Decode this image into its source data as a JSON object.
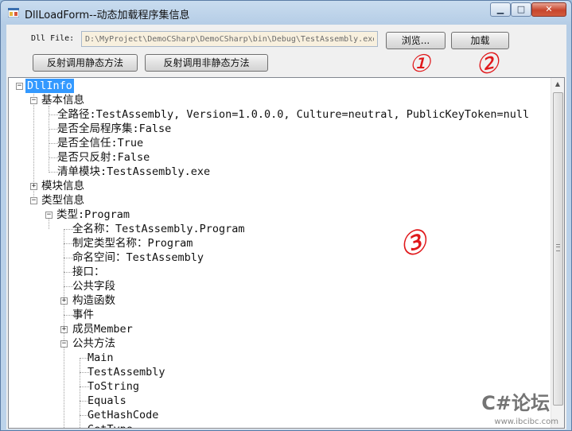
{
  "window": {
    "title": "DllLoadForm--动态加载程序集信息",
    "min_glyph": "▁",
    "max_glyph": "□",
    "close_glyph": "✕"
  },
  "toolbar": {
    "dll_label": "Dll File:",
    "dll_path": "D:\\MyProject\\DemoCSharp\\DemoCSharp\\bin\\Debug\\TestAssembly.exe",
    "browse_label": "浏览...",
    "load_label": "加载",
    "invoke_static_label": "反射调用静态方法",
    "invoke_nonstatic_label": "反射调用非静态方法"
  },
  "annotations": {
    "mark1": "①",
    "mark2": "②",
    "mark3": "③"
  },
  "tree": {
    "root": "DllInfo",
    "basic": "基本信息",
    "full_path": "全路径:TestAssembly, Version=1.0.0.0, Culture=neutral, PublicKeyToken=null",
    "is_gac": "是否全局程序集:False",
    "is_full_trust": "是否全信任:True",
    "is_reflection_only": "是否只反射:False",
    "manifest_module": "清单模块:TestAssembly.exe",
    "modules": "模块信息",
    "types": "类型信息",
    "type_program": "类型:Program",
    "full_name": "全名称：TestAssembly.Program",
    "declared_name": "制定类型名称：Program",
    "namespace": "命名空间：TestAssembly",
    "interfaces": "接口：",
    "public_fields": "公共字段",
    "constructors": "构造函数",
    "events": "事件",
    "members": "成员Member",
    "public_methods": "公共方法",
    "methods": [
      "Main",
      "TestAssembly",
      "ToString",
      "Equals",
      "GetHashCode",
      "GetType"
    ],
    "expander_plus": "+",
    "expander_minus": "−"
  },
  "scrollbar": {
    "up_glyph": "▲",
    "position": 0.0
  },
  "watermark": {
    "brand": "C#论坛",
    "url": "www.ibcibc.com"
  }
}
